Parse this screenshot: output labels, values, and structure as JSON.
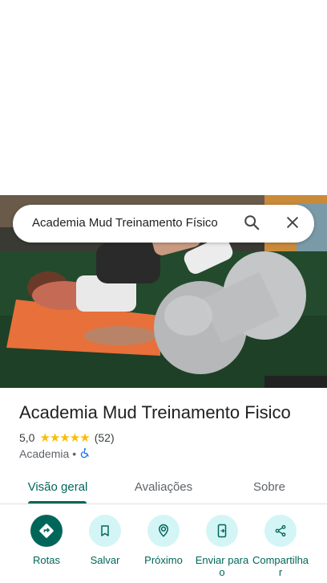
{
  "search": {
    "query": "Academia Mud Treinamento Físico"
  },
  "icons": {
    "search": "search-icon",
    "close": "close-icon",
    "wheelchair": "wheelchair-accessible-icon",
    "directions": "directions-icon",
    "save": "bookmark-icon",
    "nearby": "nearby-icon",
    "send": "send-to-phone-icon",
    "share": "share-icon"
  },
  "place": {
    "title": "Academia Mud Treinamento Fisico",
    "rating": "5,0",
    "stars": "★★★★★",
    "review_count": "(52)",
    "category": "Academia",
    "separator": "•"
  },
  "tabs": [
    {
      "label": "Visão geral",
      "active": true
    },
    {
      "label": "Avaliações",
      "active": false
    },
    {
      "label": "Sobre",
      "active": false
    }
  ],
  "actions": [
    {
      "label": "Rotas"
    },
    {
      "label": "Salvar"
    },
    {
      "label": "Próximo"
    },
    {
      "label": "Enviar para o"
    },
    {
      "label": "Compartilha r"
    }
  ],
  "colors": {
    "accent": "#00665a",
    "accent_light": "#d4f5f5",
    "star": "#fbbc04"
  }
}
